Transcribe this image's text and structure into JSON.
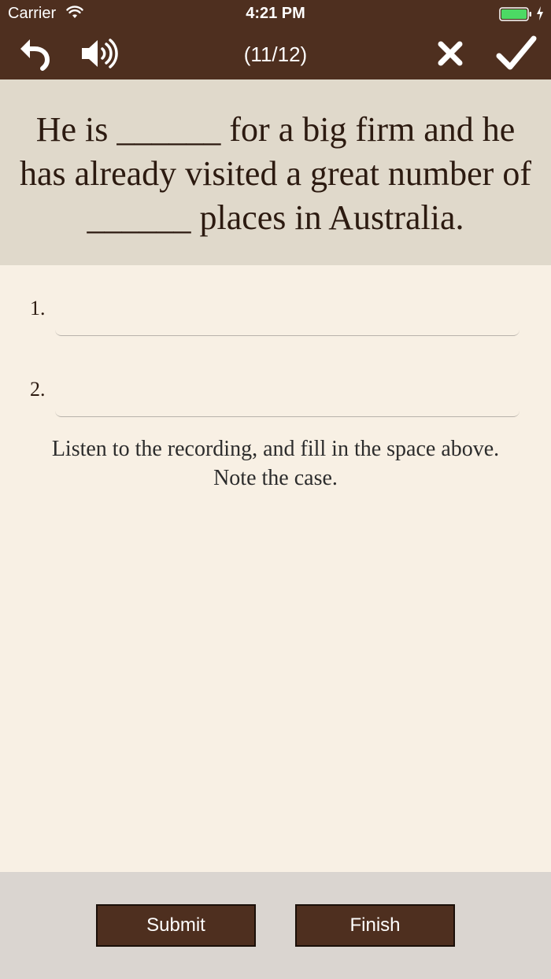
{
  "status_bar": {
    "carrier": "Carrier",
    "time": "4:21 PM"
  },
  "nav": {
    "counter": "(11/12)",
    "icons": [
      "back-arrow-icon",
      "speaker-icon",
      "close-icon",
      "checkmark-icon"
    ]
  },
  "question": {
    "text": "He is ______ for a big firm and he has already visited a great number of ______ places in Australia."
  },
  "answers": [
    {
      "number": "1.",
      "value": "",
      "placeholder": ""
    },
    {
      "number": "2.",
      "value": "",
      "placeholder": ""
    }
  ],
  "instructions": {
    "line1": "Listen to the recording, and fill in the space above.",
    "line2": "Note the case."
  },
  "buttons": {
    "submit": "Submit",
    "finish": "Finish"
  },
  "colors": {
    "header_bg": "#4e2f1f",
    "question_bg": "#e0d9cb",
    "content_bg": "#f8f0e4",
    "bottom_bg": "#dad5d0",
    "battery_green": "#4cd964"
  }
}
